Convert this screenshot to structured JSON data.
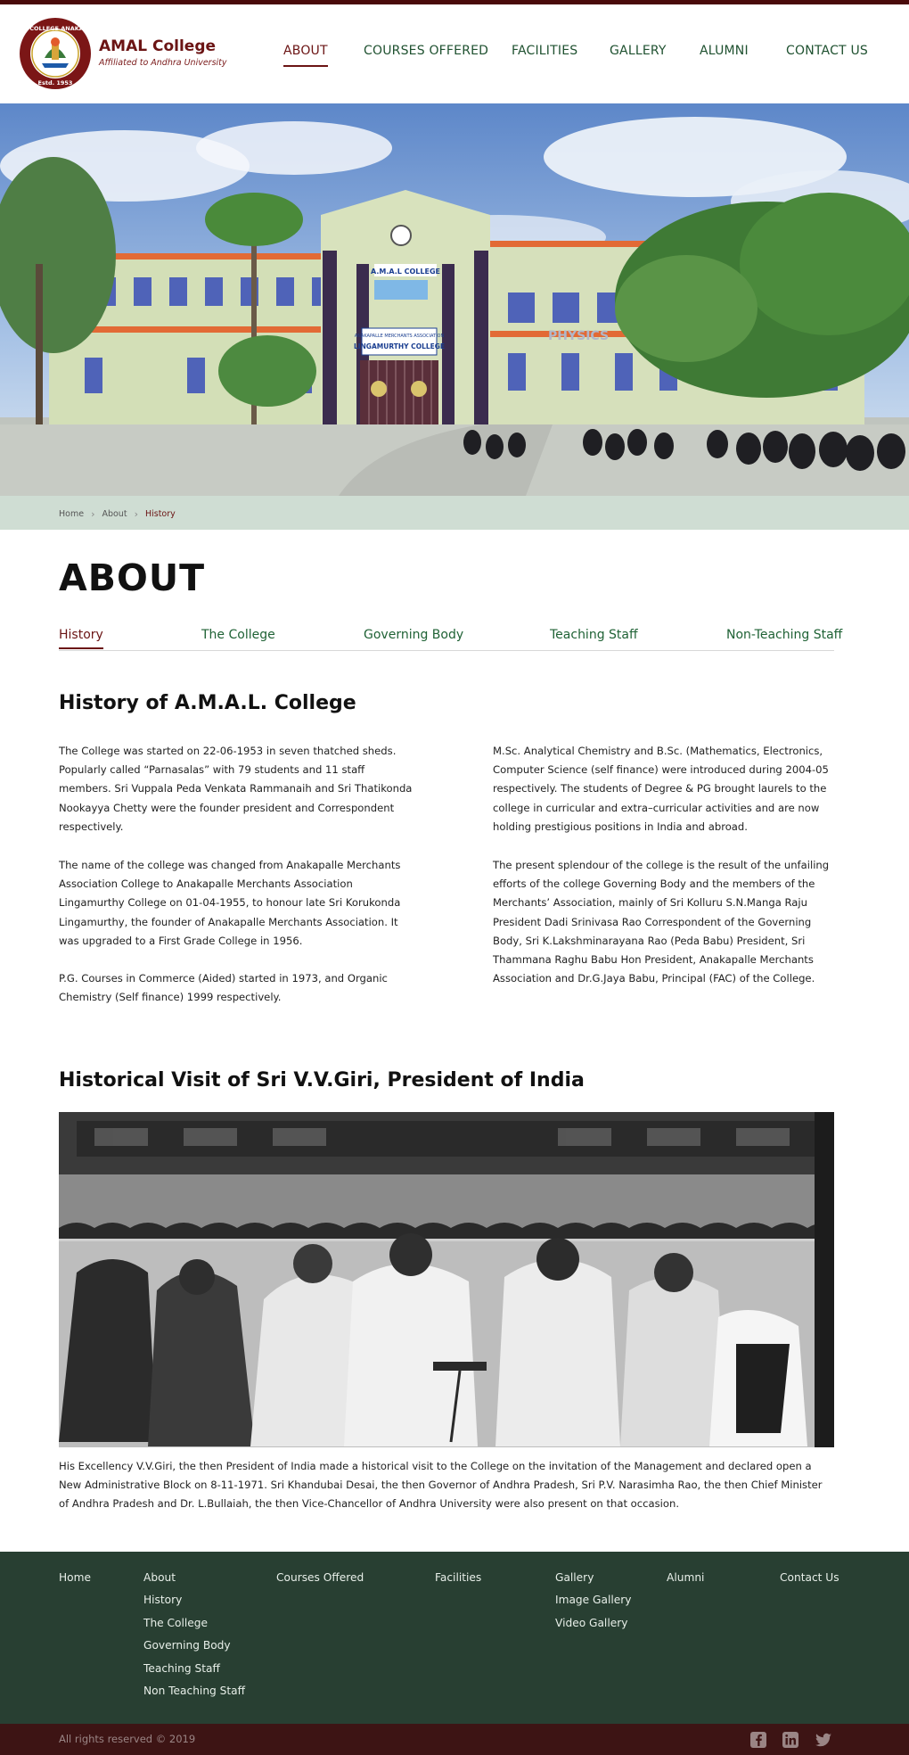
{
  "brand": {
    "name": "AMAL College",
    "tagline": "Affiliated to Andhra University",
    "logo_ring_top": "AMAL COLLEGE ANAKAPALLI",
    "logo_ring_bottom": "Estd. 1953"
  },
  "nav": {
    "items": [
      {
        "label": "ABOUT",
        "active": true
      },
      {
        "label": "COURSES OFFERED",
        "active": false
      },
      {
        "label": "FACILITIES",
        "active": false
      },
      {
        "label": "GALLERY",
        "active": false
      },
      {
        "label": "ALUMNI",
        "active": false
      },
      {
        "label": "CONTACT US",
        "active": false
      }
    ]
  },
  "hero": {
    "building_signs": [
      "A.M.A.L COLLEGE",
      "ANAKAPALLE MERCHANTS ASSOCIATION",
      "LINGAMURTHY COLLEGE",
      "PHYSICS"
    ]
  },
  "breadcrumb": {
    "items": [
      "Home",
      "About",
      "History"
    ]
  },
  "page_title": "ABOUT",
  "subtabs": {
    "items": [
      {
        "label": "History",
        "active": true
      },
      {
        "label": "The College",
        "active": false
      },
      {
        "label": "Governing Body",
        "active": false
      },
      {
        "label": "Teaching Staff",
        "active": false
      },
      {
        "label": "Non-Teaching Staff",
        "active": false
      }
    ]
  },
  "history": {
    "title": "History of  A.M.A.L. College",
    "left_paragraphs": [
      "The College was started on 22-06-1953 in seven thatched sheds. Popularly called “Parnasalas” with 79 students and 11 staff members. Sri Vuppala Peda Venkata Rammanaih and Sri Thatikonda Nookayya Chetty were the founder president and Correspondent respectively.",
      "The name of the college was changed from Anakapalle Merchants Association College to Anakapalle Merchants Association Lingamurthy College on 01-04-1955, to honour late Sri Korukonda Lingamurthy,  the founder of Anakapalle Merchants Association. It was upgraded to a First Grade College in 1956.",
      "P.G. Courses in Commerce (Aided) started in 1973,  and Organic Chemistry (Self finance) 1999 respectively."
    ],
    "right_paragraphs": [
      "M.Sc. Analytical Chemistry and B.Sc. (Mathematics, Electronics, Computer Science (self finance) were introduced during 2004-05 respectively. The students of Degree & PG brought laurels to the college in curricular and extra–curricular activities and are now holding prestigious positions in India and abroad.",
      "The present splendour of the college is the result of the unfailing efforts of the college Governing Body and the members of the Merchants’ Association, mainly of Sri Kolluru S.N.Manga Raju President Dadi Srinivasa Rao Correspondent of the Governing Body, Sri K.Lakshminarayana Rao (Peda Babu) President, Sri Thammana Raghu Babu Hon President, Anakapalle Merchants Association and Dr.G.Jaya Babu, Principal (FAC) of the College."
    ]
  },
  "visit": {
    "title": "Historical Visit of Sri V.V.Giri, President of India",
    "caption": "His Excellency V.V.Giri, the then President of India made a historical visit to the College on the invitation of the Management and declared open a New Administrative Block on 8-11-1971. Sri Khandubai Desai, the then Governor of Andhra Pradesh, Sri P.V. Narasimha Rao, the then Chief Minister of Andhra Pradesh and Dr. L.Bullaiah, the then Vice-Chancellor of Andhra University were also present on that occasion."
  },
  "footer": {
    "columns": [
      {
        "links": [
          "Home"
        ]
      },
      {
        "links": [
          "About",
          "History",
          "The College",
          "Governing Body",
          "Teaching Staff",
          "Non Teaching Staff"
        ]
      },
      {
        "links": [
          "Courses Offered"
        ]
      },
      {
        "links": [
          "Facilities"
        ]
      },
      {
        "links": [
          "Gallery",
          "Image Gallery",
          "Video Gallery"
        ]
      },
      {
        "links": [
          "Alumni"
        ]
      },
      {
        "links": [
          "Contact Us"
        ]
      }
    ],
    "copyright": "All rights reserved © 2019",
    "social": [
      "facebook-icon",
      "linkedin-icon",
      "twitter-icon"
    ]
  },
  "colors": {
    "brand_maroon": "#6b1414",
    "nav_green": "#1f5130",
    "breadcrumb_bg": "#cfddd3",
    "footer_bg": "#283f32",
    "bottom_bar_bg": "#3d1414"
  }
}
